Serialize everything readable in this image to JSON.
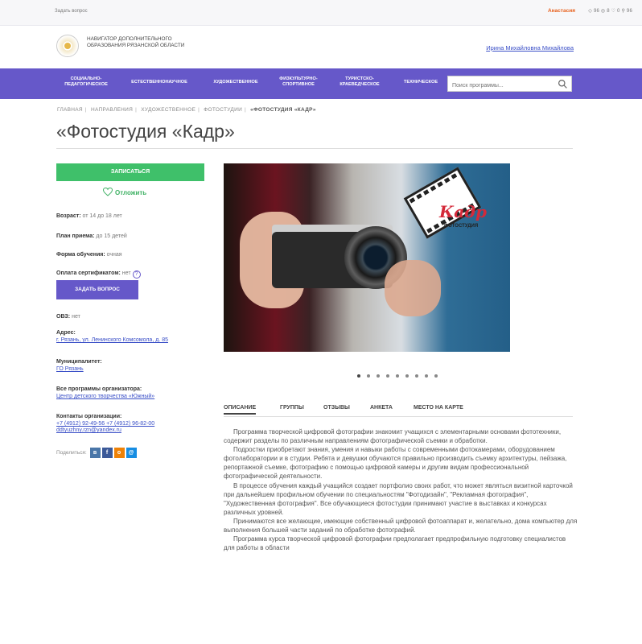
{
  "topbar": {
    "ask_label": "Задать вопрос",
    "user_name": "Анастасия",
    "counters": "◇ 96  ◎ 8  ♡ 0  ⚲ 96"
  },
  "header": {
    "logo_text": "Навигатор дополнительного образования Рязанской области",
    "user_link": "Ирина Михайловна Михайлова"
  },
  "nav": {
    "items": [
      "Социально-педагогическое",
      "Естественнонаучное",
      "Художественное",
      "Физкультурно-спортивное",
      "Туристско-краеведческое",
      "Техническое"
    ],
    "search_placeholder": "Поиск программы..."
  },
  "breadcrumb": {
    "items": [
      "Главная",
      "Направления",
      "Художественное",
      "Фотостудии"
    ],
    "current": "«Фотостудия «Кадр»"
  },
  "page_title": "«Фотостудия «Кадр»",
  "sidebar": {
    "enroll_label": "Записаться",
    "postpone_label": "Отложить",
    "age_label": "Возраст:",
    "age_value": "от 14 до 18 лет",
    "plan_label": "План приема:",
    "plan_value": "до 15 детей",
    "form_label": "Форма обучения:",
    "form_value": "очная",
    "cert_label": "Оплата сертификатом:",
    "cert_value": "нет",
    "ask_button": "Задать вопрос",
    "ovz_label": "ОВЗ:",
    "ovz_value": "нет",
    "address_label": "Адрес:",
    "address_value": "г. Рязань, ул. Ленинского Комсомола, д. 85",
    "municipality_label": "Муниципалитет:",
    "municipality_value": "ГО Рязань",
    "org_programs_label": "Все программы организатора:",
    "org_programs_value": "Центр детского творчества «Южный»",
    "contacts_label": "Контакты организации:",
    "contacts_phone": "+7 (4912) 92-49-56 +7 (4912) 96-82-00",
    "contacts_email": "ddtyuzhny.rzn@yandex.ru",
    "share_label": "Поделиться:"
  },
  "photo": {
    "logo_word": "Кадр",
    "logo_sub": "фотостудия"
  },
  "slider": {
    "count": 9,
    "active": 0
  },
  "tabs": [
    "Описание",
    "Группы",
    "Отзывы",
    "Анкета",
    "Место на карте"
  ],
  "description": [
    "Программа творческой цифровой фотографии знакомит учащихся с элементарными основами фототехники, содержит разделы по различным направлениям фотографической съемки и обработки.",
    "Подростки приобретают знания, умения и навыки работы с современными фотокамерами, оборудованием фотолаборатории и в студии. Ребята и девушки обучаются правильно производить съемку архитектуры, пейзажа, репортажной съемке, фотографию с помощью цифровой камеры и другим видам профессиональной фотографической деятельности.",
    "В процессе обучения каждый учащийся создает портфолио своих работ, что может являться визитной карточкой при дальнейшем профильном обучении по специальностям \"Фотодизайн\", \"Рекламная фотография\", \"Художественная фотография\". Все обучающиеся фотостудии принимают участие в выставках и конкурсах различных уровней.",
    "Принимаются все желающие, имеющие собственный цифровой фотоаппарат и, желательно, дома компьютер для выполнения большей части заданий по обработке фотографий.",
    "Программа курса творческой цифровой фотографии предполагает предпрофильную подготовку специалистов для работы в области"
  ],
  "colors": {
    "nav_bg": "#6658c9",
    "enroll_green": "#3fc06a",
    "link_blue": "#3a4fc7",
    "user_orange": "#e8601c"
  }
}
